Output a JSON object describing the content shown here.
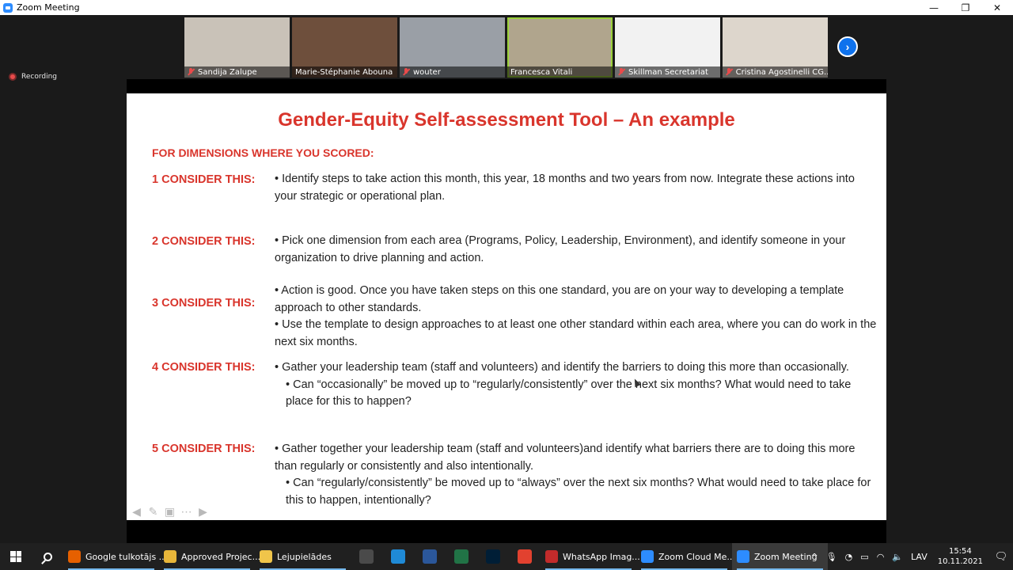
{
  "window": {
    "title": "Zoom Meeting",
    "controls": {
      "minimize": "—",
      "maximize": "❐",
      "close": "✕"
    }
  },
  "recording": {
    "label": "Recording",
    "color": "#e84b4b"
  },
  "participants": [
    {
      "name": "Sandija Zalupe",
      "muted": true,
      "bg": "#c9c2b8"
    },
    {
      "name": "Marie-Stéphanie Abouna",
      "muted": false,
      "bg": "#6e4f3c"
    },
    {
      "name": "wouter",
      "muted": true,
      "bg": "#9a9fa6"
    },
    {
      "name": "Francesca Vitali",
      "muted": false,
      "active": true,
      "bg": "#b0a58d"
    },
    {
      "name": "Skillman Secretariat",
      "muted": true,
      "bg": "#f2f2f2"
    },
    {
      "name": "Cristina Agostinelli CG...",
      "muted": true,
      "bg": "#ddd6cc"
    }
  ],
  "slide": {
    "title": "Gender-Equity Self-assessment Tool – An example",
    "subtitle": "FOR DIMENSIONS WHERE YOU SCORED:",
    "accent": "#d9352c",
    "items": [
      {
        "label": "1 CONSIDER THIS:",
        "lines": [
          "• Identify steps to take action this month, this year, 18 months and two years from now. Integrate these actions into your strategic or operational plan."
        ]
      },
      {
        "label": "2 CONSIDER THIS:",
        "lines": [
          "• Pick one dimension from each area (Programs, Policy, Leadership, Environment), and identify someone in your organization to drive planning and action."
        ]
      },
      {
        "label": "3 CONSIDER THIS:",
        "lines": [
          "• Action is good. Once you have taken steps on this one standard, you are on your way to developing a template approach to other standards.",
          "• Use the template to design approaches to at least one other standard within each area, where you can do work in the next six months."
        ]
      },
      {
        "label": "4 CONSIDER THIS:",
        "lines": [
          "• Gather your leadership team (staff and volunteers) and identify the barriers to doing this more than occasionally.",
          "• Can “occasionally” be moved up to “regularly/consistently” over the next six months? What would need to take place for this to happen?"
        ]
      },
      {
        "label": "5 CONSIDER THIS:",
        "lines": [
          "• Gather together your leadership team (staff and volunteers)and identify what barriers there are to doing this more than regularly or consistently and also intentionally.",
          "• Can “regularly/consistently” be moved up to “always” over the next six months? What would need to take place for this to happen, intentionally?"
        ]
      }
    ],
    "controls": [
      "arrow-left-icon",
      "pen-icon",
      "slides-icon",
      "more-icon",
      "arrow-right-icon"
    ]
  },
  "taskbar": {
    "apps": [
      {
        "label": "Google tulkotājs ...",
        "icon": "firefox-icon",
        "color": "#e66000",
        "running": true
      },
      {
        "label": "Approved Projec...",
        "icon": "folder-icon",
        "color": "#e8b63a",
        "running": true
      },
      {
        "label": "Lejupielādes",
        "icon": "folder-download-icon",
        "color": "#f0c54a",
        "running": true
      }
    ],
    "pinned": [
      {
        "icon": "filmstrip-icon",
        "color": "#4a4a4a"
      },
      {
        "icon": "edge-icon",
        "color": "#1f8ad6"
      },
      {
        "icon": "word-icon",
        "color": "#2b579a"
      },
      {
        "icon": "excel-icon",
        "color": "#217346"
      },
      {
        "icon": "photoshop-icon",
        "color": "#001e36"
      },
      {
        "icon": "chrome-icon",
        "color": "#e2412f"
      }
    ],
    "apps2": [
      {
        "label": "WhatsApp Imag...",
        "icon": "image-icon",
        "color": "#c22b2b",
        "running": true
      },
      {
        "label": "Zoom Cloud Me...",
        "icon": "zoom-icon",
        "color": "#2d8cff",
        "running": true
      },
      {
        "label": "Zoom Meeting",
        "icon": "zoom-icon",
        "color": "#2d8cff",
        "running": true,
        "active": true
      }
    ],
    "tray": {
      "chevron": "^",
      "lang": "LAV",
      "time": "15:54",
      "date": "10.11.2021"
    }
  }
}
